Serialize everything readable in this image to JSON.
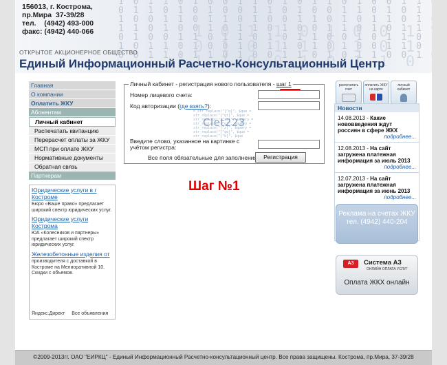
{
  "header": {
    "address_lines": [
      "156013, г. Кострома,",
      "пр.Мира  37-39/28",
      "тел.    (4942) 493-000",
      "факс: (4942) 440-066"
    ],
    "org_type": "ОТКРЫТОЕ АКЦИОНЕРНОЕ ОБЩЕСТВО",
    "org_title": "Единый Информационный Расчетно-Консультационный Центр"
  },
  "nav": {
    "main": "Главная",
    "about": "О компании",
    "pay": "Оплатить ЖКУ",
    "subscribers": "Абонентам",
    "items": [
      "Личный кабинет",
      "Распечатать квитанцию",
      "Перерасчет оплаты за ЖКУ",
      "МСП при оплате ЖКУ",
      "Нормативные документы",
      "Обратная связь"
    ],
    "partners": "Партнерам"
  },
  "ads": {
    "items": [
      {
        "link": "Юридические услуги в г Костроме",
        "text": "Бюро «Ваше право» предлагает широкий спектр юридических услуг."
      },
      {
        "link": "Юридические услуги Кострома",
        "text": "ЮА «Колесников и партнеры» предлагает широкий спектр юридических услуг."
      },
      {
        "link": "Железобетонные изделия от",
        "text": "производителя с доставкой в Костроме на Мелиоративной 10. Скидки с объемов."
      }
    ],
    "footer": [
      "Яндекс.Директ",
      "Все объявления"
    ]
  },
  "form": {
    "title_prefix": "Личный кабинет - регистрация нового пользователя - ",
    "title_step": "шаг 1",
    "account_label": "Номер лицевого счета:",
    "auth_label_prefix": "Код авторизации (",
    "auth_help_link": "где взять?",
    "auth_label_suffix": "):",
    "captcha_text": "Clet223",
    "captcha_label": "Введите слово, указанное на картинке с учётом регистра:",
    "required_note": "Все поля обязательные для заполнения",
    "register_button": "Регистрация"
  },
  "step_label": "Шаг №1",
  "service_icons": [
    "распечатать счет",
    "оплатить ЖКУ на карте",
    "личный кабинет"
  ],
  "news": {
    "header": "Новости",
    "items": [
      {
        "date": "14.08.2013",
        "title": "Какие нововведения ждут россиян в сфере ЖКХ"
      },
      {
        "date": "12.08.2013",
        "title": "На сайт загружена платежная информация за июль 2013"
      },
      {
        "date": "12.07.2013",
        "title": "На сайт загружена платежная информация за июнь 2013"
      }
    ],
    "more": "подробнее..."
  },
  "ad_banner": {
    "line1": "Реклама на счетах ЖКУ",
    "line2": "тел. (4942) 440-204"
  },
  "a3_banner": {
    "logo": "A3",
    "system": "Система А3",
    "subtitle": "ОНЛАЙН ОПЛАТА УСЛУГ",
    "pay": "Оплата ЖКХ онлайн"
  },
  "footer": {
    "text": "©2009-2013гг. ОАО \"ЕИРКЦ\" - Единый Информационный Расчетно-консультационный центр. Все права защищены. Кострома, пр.Мира, 37-39/28"
  }
}
